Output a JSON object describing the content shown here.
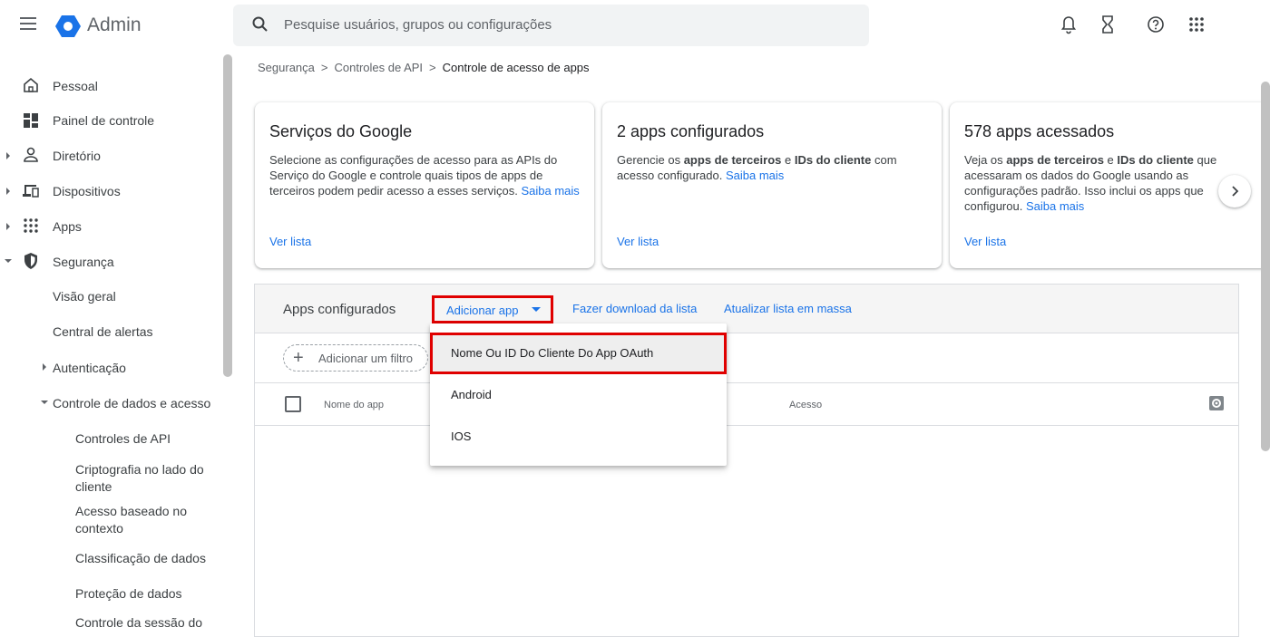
{
  "app": {
    "title": "Admin"
  },
  "search": {
    "placeholder": "Pesquise usuários, grupos ou configurações"
  },
  "sidebar": {
    "items": [
      {
        "label": "Pessoal"
      },
      {
        "label": "Painel de controle"
      },
      {
        "label": "Diretório"
      },
      {
        "label": "Dispositivos"
      },
      {
        "label": "Apps"
      },
      {
        "label": "Segurança"
      }
    ],
    "security_sub": [
      {
        "label": "Visão geral"
      },
      {
        "label": "Central de alertas"
      },
      {
        "label": "Autenticação"
      },
      {
        "label": "Controle de dados e acesso"
      }
    ],
    "data_access_sub": [
      {
        "label": "Controles de API"
      },
      {
        "label": "Criptografia no lado do cliente"
      },
      {
        "label": "Acesso baseado no contexto"
      },
      {
        "label": "Classificação de dados"
      },
      {
        "label": "Proteção de dados"
      },
      {
        "label": "Controle da sessão do"
      }
    ]
  },
  "breadcrumb": {
    "items": [
      "Segurança",
      "Controles de API",
      "Controle de acesso de apps"
    ],
    "separator": ">"
  },
  "cards": [
    {
      "title": "Serviços do Google",
      "body": "Selecione as configurações de acesso para as APIs do Serviço do Google e controle quais tipos de apps de terceiros podem pedir acesso a esses serviços.",
      "link": "Saiba mais",
      "action": "Ver lista"
    },
    {
      "title": "2 apps configurados",
      "body_pre": "Gerencie os ",
      "bold1": "apps de terceiros",
      "mid": " e ",
      "bold2": "IDs do cliente",
      "body_post": " com acesso configurado.",
      "link": "Saiba mais",
      "action": "Ver lista"
    },
    {
      "title": "578 apps acessados",
      "body_pre": "Veja os ",
      "bold1": "apps de terceiros",
      "mid": " e ",
      "bold2": "IDs do cliente",
      "body_post": " que acessaram os dados do Google usando as configurações padrão. Isso inclui os apps que configurou.",
      "link": "Saiba mais",
      "action": "Ver lista"
    }
  ],
  "panel": {
    "title": "Apps configurados",
    "add_button": "Adicionar app",
    "download": "Fazer download da lista",
    "bulk_update": "Atualizar lista em massa",
    "filter": "Adicionar um filtro",
    "columns": [
      "Nome do app",
      "Acesso"
    ]
  },
  "menu": {
    "items": [
      "Nome Ou ID Do Cliente Do App OAuth",
      "Android",
      "IOS"
    ]
  },
  "colors": {
    "accent": "#1a73e8",
    "highlight": "#e00000",
    "logo": "#1a73e8"
  }
}
